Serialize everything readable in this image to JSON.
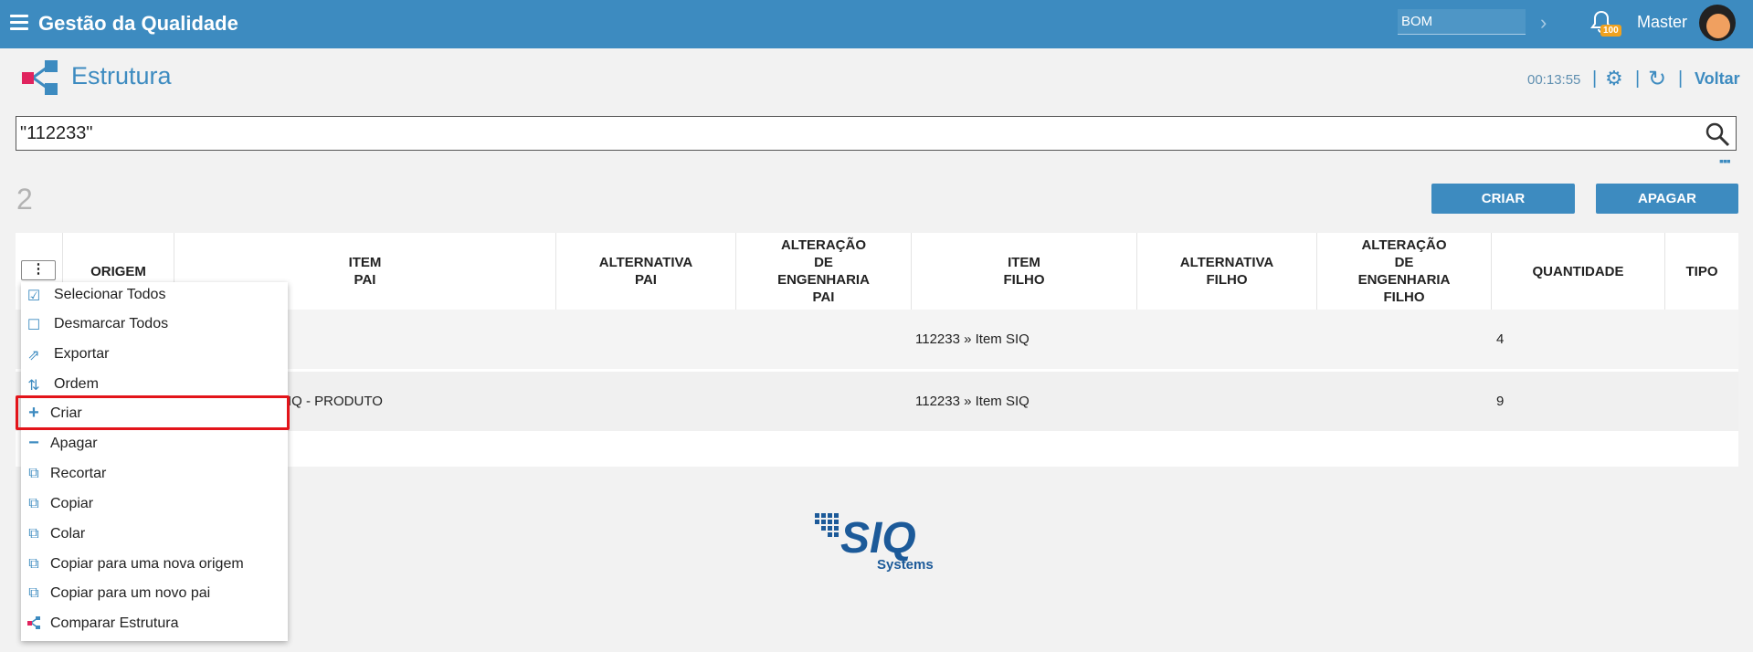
{
  "header": {
    "app_title": "Gestão da Qualidade",
    "module_value": "BOM",
    "notification_count": "100",
    "user_name": "Master"
  },
  "page": {
    "title": "Estrutura",
    "timer": "00:13:55",
    "back_label": "Voltar"
  },
  "search": {
    "value": "\"112233\""
  },
  "results": {
    "count": "2",
    "create_button": "CRIAR",
    "delete_button": "APAGAR"
  },
  "table": {
    "columns": [
      "ORIGEM",
      "ITEM\nPAI",
      "ALTERNATIVA\nPAI",
      "ALTERAÇÃO\nDE\nENGENHARIA\nPAI",
      "ITEM\nFILHO",
      "ALTERNATIVA\nFILHO",
      "ALTERAÇÃO\nDE\nENGENHARIA\nFILHO",
      "QUANTIDADE",
      "TIPO"
    ],
    "rows": [
      {
        "item_pai": "",
        "item_filho": "112233 » Item SIQ",
        "quantidade": "4"
      },
      {
        "item_pai": "IQ - PRODUTO",
        "item_filho": "112233 » Item SIQ",
        "quantidade": "9"
      }
    ]
  },
  "context_menu": {
    "items": [
      {
        "label": "Selecionar Todos",
        "icon": "checkbox-checked-icon"
      },
      {
        "label": "Desmarcar Todos",
        "icon": "checkbox-empty-icon"
      },
      {
        "label": "Exportar",
        "icon": "export-icon"
      },
      {
        "label": "Ordem",
        "icon": "sort-icon"
      },
      {
        "label": "Criar",
        "icon": "plus-icon"
      },
      {
        "label": "Apagar",
        "icon": "minus-icon"
      },
      {
        "label": "Recortar",
        "icon": "copy-icon"
      },
      {
        "label": "Copiar",
        "icon": "copy-icon"
      },
      {
        "label": "Colar",
        "icon": "copy-icon"
      },
      {
        "label": "Copiar para uma nova origem",
        "icon": "copy-icon"
      },
      {
        "label": "Copiar para um novo pai",
        "icon": "copy-icon"
      },
      {
        "label": "Comparar Estrutura",
        "icon": "structure-icon"
      }
    ]
  },
  "footer": {
    "logo_text": "SIQ",
    "logo_subtext": "Systems"
  },
  "colors": {
    "primary": "#3d8bc0",
    "badge": "#f1a21f",
    "highlight": "#e3141a"
  }
}
